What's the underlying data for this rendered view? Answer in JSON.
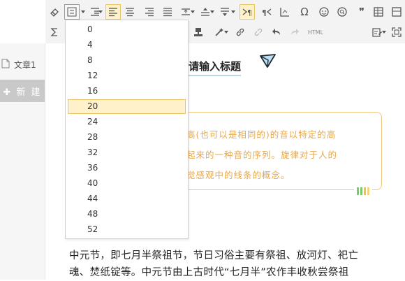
{
  "sidebar": {
    "items": [
      {
        "label": "文章1"
      }
    ],
    "new_button": "✚ 新 建"
  },
  "editor": {
    "title": "请输入标题",
    "quote_lines": [
      "高(也可以是相同的)的音以特定的高",
      "起来的一种音的序列。旋律对于人的",
      "觉感观中的线条的概念。"
    ],
    "body_lines": [
      "中元节，即七月半祭祖节，节日习俗主要有祭祖、放河灯、祀亡",
      "魂、焚纸锭等。中元节由上古时代“七月半”农作丰收秋尝祭祖"
    ],
    "accent_bars": [
      "#7ccb6a",
      "#7ccb6a",
      "#f0c14e",
      "#f3d37c"
    ]
  },
  "toolbar": {
    "html_label": "HTML",
    "omega": "Ω",
    "quote_mark": "❞"
  },
  "dropdown": {
    "options": [
      "0",
      "4",
      "8",
      "12",
      "16",
      "20",
      "24",
      "28",
      "32",
      "36",
      "40",
      "44",
      "48",
      "52"
    ],
    "selected": "20"
  },
  "colors": {
    "accent": "#e9c563",
    "quote_text": "#e8a84a"
  }
}
